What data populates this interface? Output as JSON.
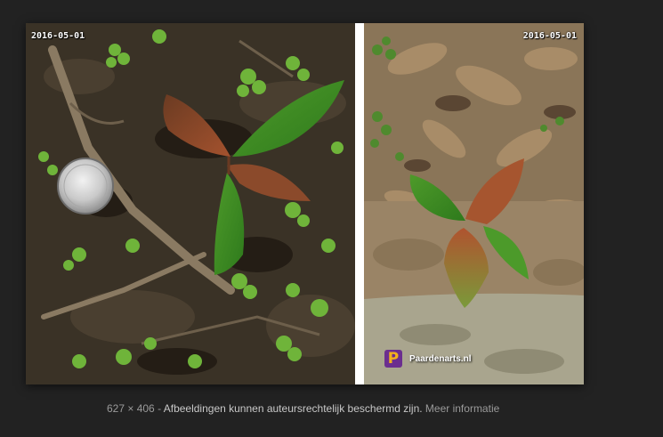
{
  "image": {
    "stamp_left": "2016-05-01",
    "stamp_right": "2016-05-01",
    "watermark_text": "Paardenarts.nl",
    "watermark_logo_letter": "P"
  },
  "caption": {
    "dimensions": "627 × 406",
    "separator": "-",
    "notice": "Afbeeldingen kunnen auteursrechtelijk beschermd zijn.",
    "more_info": "Meer informatie"
  },
  "colors": {
    "background": "#222222",
    "watermark_logo_bg": "#6b2e8f",
    "watermark_logo_fg": "#f3b21b"
  }
}
